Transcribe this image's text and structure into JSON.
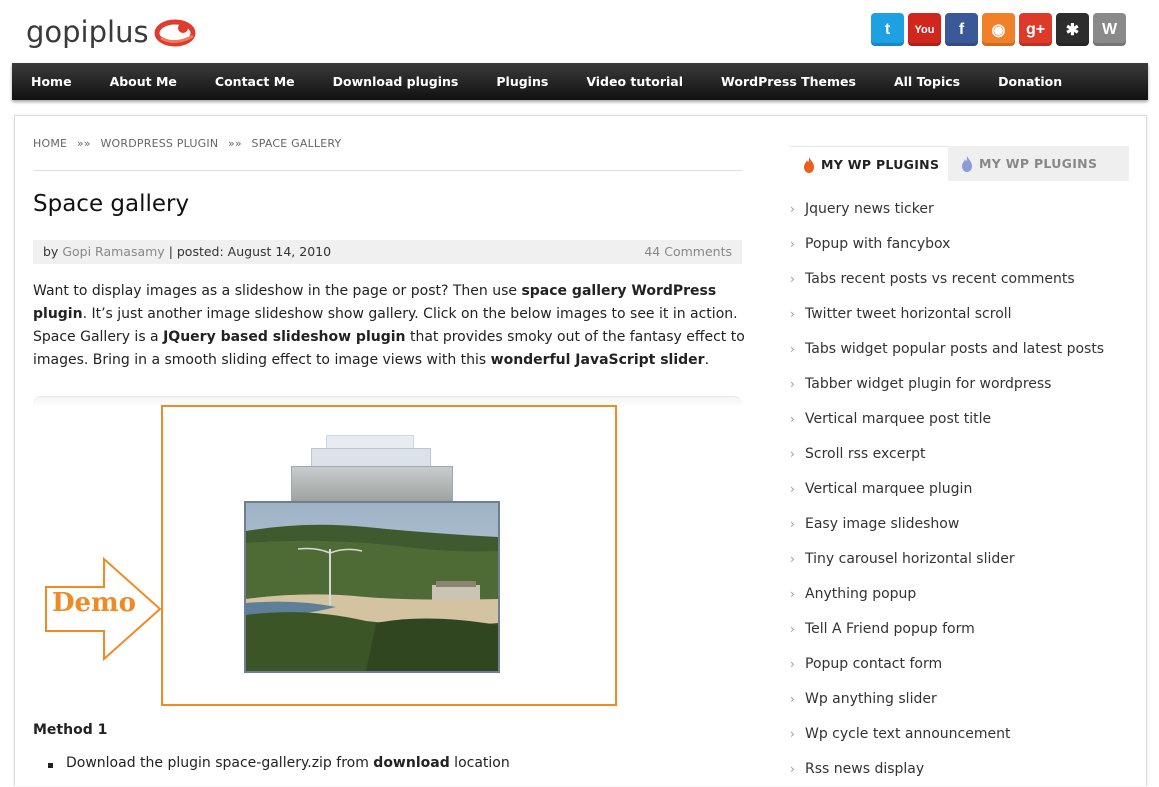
{
  "site": {
    "logo_text": "gopiplus",
    "social_icons": [
      {
        "name": "twitter-icon",
        "glyph": "t",
        "color": "#1da1e2"
      },
      {
        "name": "youtube-icon",
        "glyph": "You",
        "color": "#d1261d"
      },
      {
        "name": "facebook-icon",
        "glyph": "f",
        "color": "#3b5998"
      },
      {
        "name": "rss-icon",
        "glyph": "◉",
        "color": "#f0802a"
      },
      {
        "name": "google-plus-icon",
        "glyph": "g+",
        "color": "#dd3a2a"
      },
      {
        "name": "joomla-icon",
        "glyph": "✱",
        "color": "#2d2d2d"
      },
      {
        "name": "wordpress-icon",
        "glyph": "W",
        "color": "#8a8a8a"
      }
    ]
  },
  "nav": {
    "items": [
      "Home",
      "About Me",
      "Contact Me",
      "Download plugins",
      "Plugins",
      "Video tutorial",
      "WordPress Themes",
      "All Topics",
      "Donation"
    ]
  },
  "breadcrumb": {
    "home": "HOME",
    "sep": "»»",
    "category": "WORDPRESS PLUGIN",
    "current": "SPACE GALLERY"
  },
  "post": {
    "title": "Space gallery",
    "meta_by": "by",
    "author": "Gopi Ramasamy",
    "meta_posted": "| posted: August 14, 2010",
    "comments": "44 Comments",
    "para": {
      "p1": "Want to display images as a slideshow in the page or post? Then use ",
      "b1": "space gallery WordPress plugin",
      "p2": ". It’s just another image slideshow show gallery. Click on the below images to see it in action. Space Gallery is a ",
      "b2": "JQuery based slideshow plugin",
      "p3": " that provides smoky out of the fantasy effect to images. Bring in a smooth sliding effect to image views with this ",
      "b3": "wonderful JavaScript slider",
      "p4": "."
    },
    "demo_label": "Demo",
    "method_heading": "Method 1",
    "bullet": {
      "pre": "Download the plugin space-gallery.zip from ",
      "bold": "download",
      "post": " location"
    }
  },
  "sidebar": {
    "tab_active": "MY WP PLUGINS",
    "tab_inactive": "MY WP PLUGINS",
    "plugins": [
      "Jquery news ticker",
      "Popup with fancybox",
      "Tabs recent posts vs recent comments",
      "Twitter tweet horizontal scroll",
      "Tabs widget popular posts and latest posts",
      "Tabber widget plugin for wordpress",
      "Vertical marquee post title",
      "Scroll rss excerpt",
      "Vertical marquee plugin",
      "Easy image slideshow",
      "Tiny carousel horizontal slider",
      "Anything popup",
      "Tell A Friend popup form",
      "Popup contact form",
      "Wp anything slider",
      "Wp cycle text announcement",
      "Rss news display"
    ]
  },
  "colors": {
    "accent_orange": "#f08a24",
    "nav_bg": "#1c1c1c",
    "flame_active": "#e8601c",
    "flame_inactive": "#8c9ad8"
  }
}
